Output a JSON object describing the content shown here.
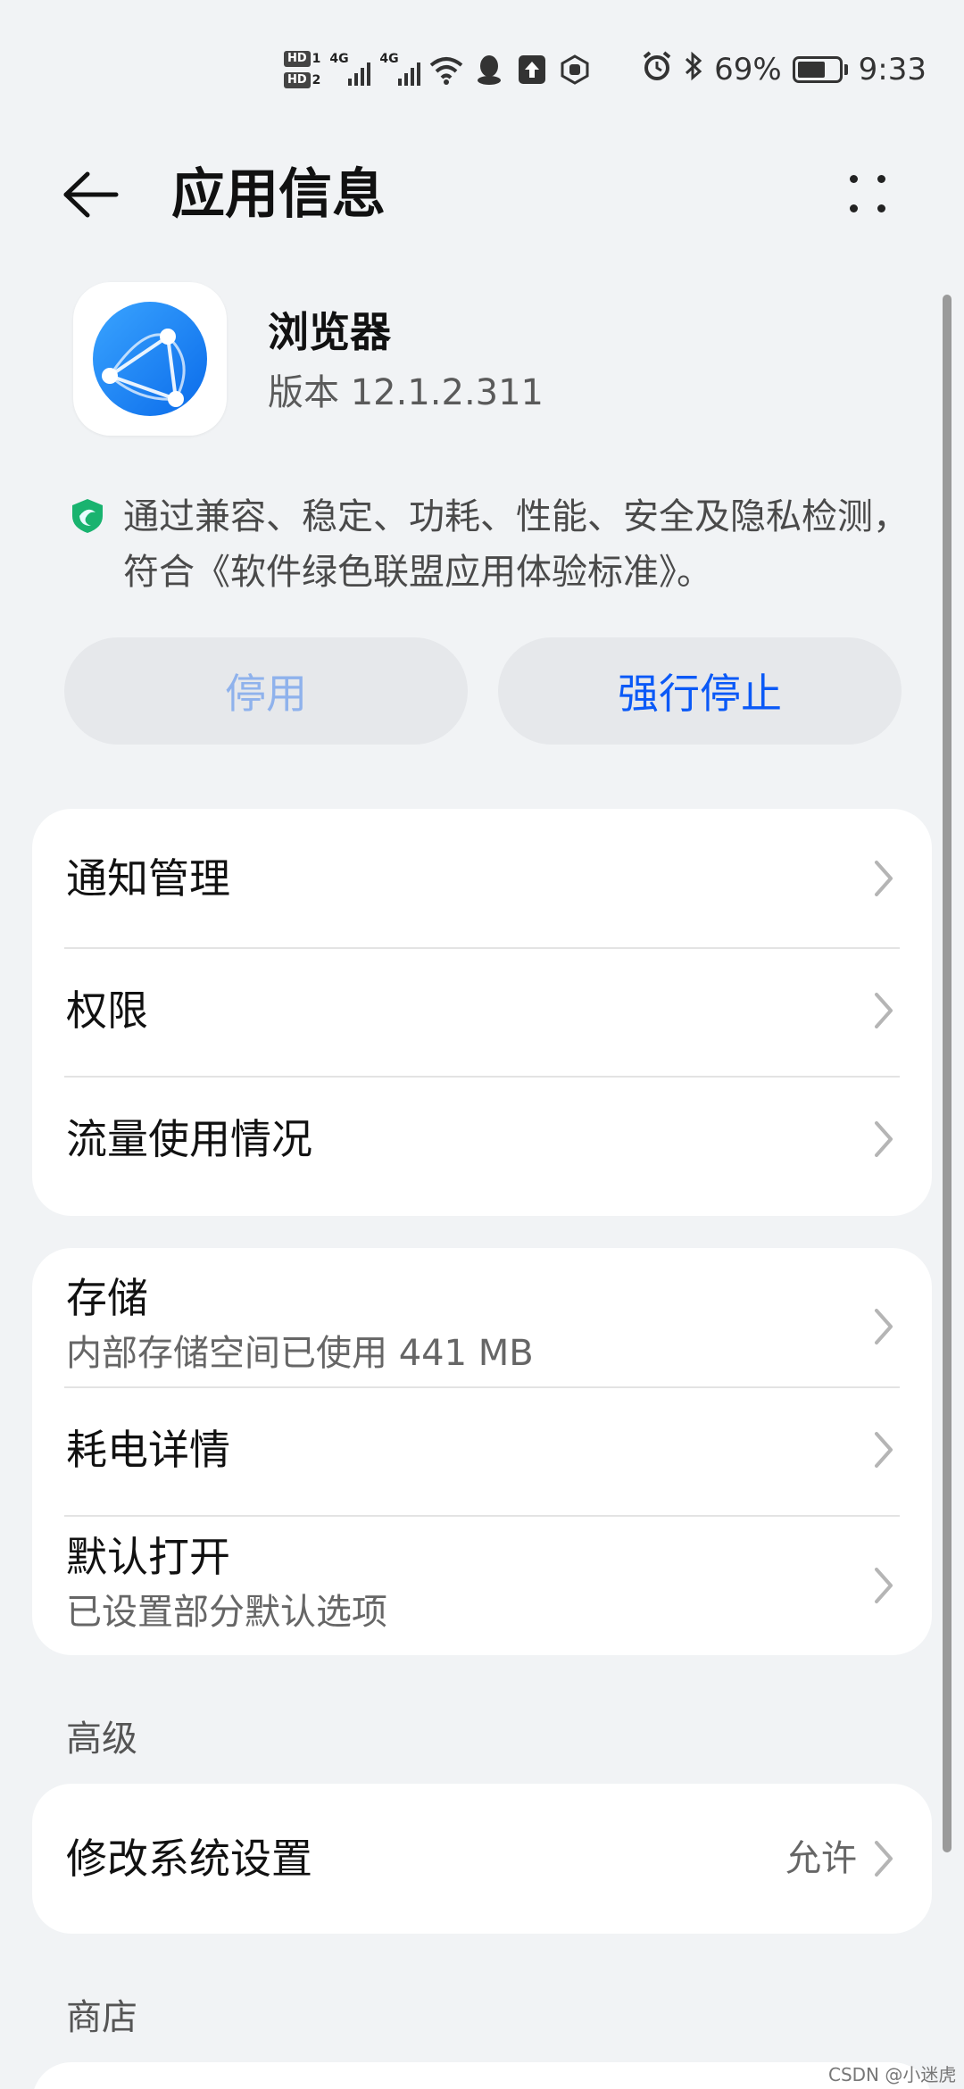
{
  "status_bar": {
    "hd1_label": "HD",
    "hd1_num": "1",
    "hd2_label": "HD",
    "hd2_num": "2",
    "sig1_tag": "4G",
    "sig2_tag": "4G",
    "battery_percent": "69%",
    "battery_level": 0.69,
    "time": "9:33",
    "icons": [
      "hd-icon",
      "signal-icon",
      "signal-icon",
      "wifi-icon",
      "qq-icon",
      "upload-icon",
      "shield-icon",
      "alarm-icon",
      "bluetooth-icon",
      "battery-icon"
    ]
  },
  "header": {
    "title": "应用信息"
  },
  "app": {
    "name": "浏览器",
    "version": "版本 12.1.2.311",
    "certification": "通过兼容、稳定、功耗、性能、安全及隐私检测，符合《软件绿色联盟应用体验标准》。"
  },
  "actions": {
    "disable_label": "停用",
    "force_stop_label": "强行停止"
  },
  "group1": [
    {
      "title": "通知管理"
    },
    {
      "title": "权限"
    },
    {
      "title": "流量使用情况"
    }
  ],
  "group2": [
    {
      "title": "存储",
      "subtitle": "内部存储空间已使用 441 MB"
    },
    {
      "title": "耗电详情"
    },
    {
      "title": "默认打开",
      "subtitle": "已设置部分默认选项"
    }
  ],
  "advanced": {
    "section_title": "高级",
    "items": [
      {
        "title": "修改系统设置",
        "value": "允许"
      }
    ]
  },
  "store": {
    "section_title": "商店"
  },
  "watermark": "CSDN @小迷虎儿",
  "colors": {
    "accent": "#0a59f7",
    "disabled_text": "#8fb2ec",
    "background": "#f1f3f5",
    "card": "#ffffff"
  }
}
